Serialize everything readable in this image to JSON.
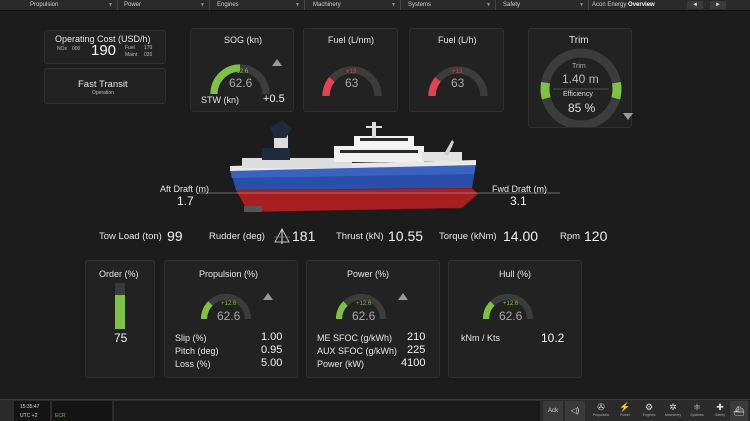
{
  "menu": [
    {
      "label": "Propulsion"
    },
    {
      "label": "Power"
    },
    {
      "label": "Engines"
    },
    {
      "label": "Machinery"
    },
    {
      "label": "Systems"
    },
    {
      "label": "Safety"
    }
  ],
  "title": {
    "prefix": "Acon Energy",
    "bold": "Overview"
  },
  "nav": {
    "back": "◄",
    "forward": "►"
  },
  "cost": {
    "label": "Operating Cost (USD/h)",
    "nox_label": "NOx",
    "nox_value": "000",
    "value": "190",
    "fuel_label": "Fuel",
    "fuel_value": "170",
    "maint_label": "Maint",
    "maint_value": "020"
  },
  "mode": {
    "label": "Fast Transit",
    "sub": "Operation"
  },
  "sog": {
    "label": "SOG (kn)",
    "delta": "+12.6",
    "value": "62.6",
    "fraction": 0.5,
    "color": "#7dc242",
    "stw_label": "STW (kn)",
    "stw_value": "+0.5"
  },
  "fuel_nm": {
    "label": "Fuel (L/nm)",
    "delta": "+13",
    "value": "63",
    "fraction": 0.22,
    "color": "#e2434f"
  },
  "fuel_h": {
    "label": "Fuel (L/h)",
    "delta": "+13",
    "value": "63",
    "fraction": 0.22,
    "color": "#e2434f"
  },
  "trim": {
    "label": "Trim",
    "sub1": "Trim",
    "value1": "1.40 m",
    "sub2": "Efficiency",
    "value2": "85 %",
    "color": "#7dc242"
  },
  "drafts": {
    "aft_label": "Aft Draft (m)",
    "aft_value": "1.7",
    "fwd_label": "Fwd Draft (m)",
    "fwd_value": "3.1"
  },
  "metrics": [
    {
      "label": "Tow Load (ton)",
      "value": "99"
    },
    {
      "label": "Rudder (deg)",
      "value": "181"
    },
    {
      "label": "Thrust (kN)",
      "value": "10.55"
    },
    {
      "label": "Torque (kNm)",
      "value": "14.00"
    },
    {
      "label": "Rpm",
      "value": "120"
    }
  ],
  "order": {
    "label": "Order (%)",
    "value": "75",
    "fraction": 0.75,
    "color": "#7dc242"
  },
  "propulsion": {
    "label": "Propulsion (%)",
    "delta": "+12.6",
    "value": "62.6",
    "fraction": 0.25,
    "color": "#7dc242",
    "rows": [
      {
        "label": "Slip (%)",
        "value": "1.00"
      },
      {
        "label": "Pitch (deg)",
        "value": "0.95"
      },
      {
        "label": "Loss (%)",
        "value": "5.00"
      }
    ]
  },
  "power": {
    "label": "Power (%)",
    "delta": "+12.6",
    "value": "62.6",
    "fraction": 0.25,
    "color": "#7dc242",
    "rows": [
      {
        "label": "ME SFOC (g/kWh)",
        "value": "210"
      },
      {
        "label": "AUX SFOC (g/kWh)",
        "value": "225"
      },
      {
        "label": "Power (kW)",
        "value": "4100"
      }
    ]
  },
  "hull": {
    "label": "Hull (%)",
    "delta": "+12.6",
    "value": "62.6",
    "fraction": 0.25,
    "color": "#7dc242",
    "rows": [
      {
        "label": "kNm / Kts",
        "value": "10.2"
      }
    ]
  },
  "status": {
    "time": "15:35:47",
    "tz": "UTC +2",
    "line": "ECR"
  },
  "ack_label": "Ack",
  "icons": [
    {
      "name": "propulsion-icon",
      "glyph": "✇",
      "label": "Propulsion"
    },
    {
      "name": "power-icon",
      "glyph": "⚡",
      "label": "Power"
    },
    {
      "name": "engines-icon",
      "glyph": "⚙",
      "label": "Engines"
    },
    {
      "name": "machinery-icon",
      "glyph": "✲",
      "label": "Machinery"
    },
    {
      "name": "systems-icon",
      "glyph": "⚛",
      "label": "Systems"
    },
    {
      "name": "safety-icon",
      "glyph": "✚",
      "label": "Safety"
    },
    {
      "name": "overview-icon",
      "glyph": "⛴",
      "label": ""
    }
  ]
}
